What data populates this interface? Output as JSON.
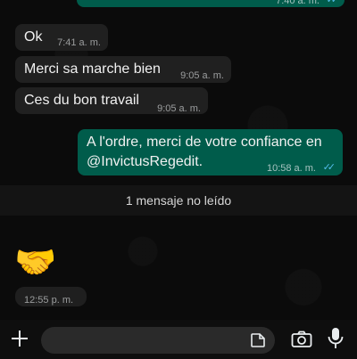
{
  "messages": [
    {
      "type": "out",
      "text": "",
      "time": "7:40 a. m."
    },
    {
      "type": "in",
      "text": "Ok",
      "time": "7:41 a. m."
    },
    {
      "type": "in",
      "text": "Merci sa marche bien",
      "time": "9:05 a. m."
    },
    {
      "type": "in",
      "text": "Ces du bon travail",
      "time": "9:05 a. m."
    },
    {
      "type": "out",
      "text_line1": "A l'ordre, merci de votre confiance en",
      "text_line2": "@InvictusRegedit.",
      "time": "10:58 a. m."
    }
  ],
  "unread_label": "1 mensaje no leído",
  "last_message": {
    "emoji": "🤝",
    "time": "12:55 p. m."
  },
  "composer": {
    "placeholder": ""
  },
  "icons": {
    "add": "plus-icon",
    "sticker": "sticker-icon",
    "camera": "camera-icon",
    "mic": "mic-icon"
  },
  "colors": {
    "outgoing": "#005c4b",
    "incoming": "#202020",
    "read_ticks": "#53bdeb"
  }
}
